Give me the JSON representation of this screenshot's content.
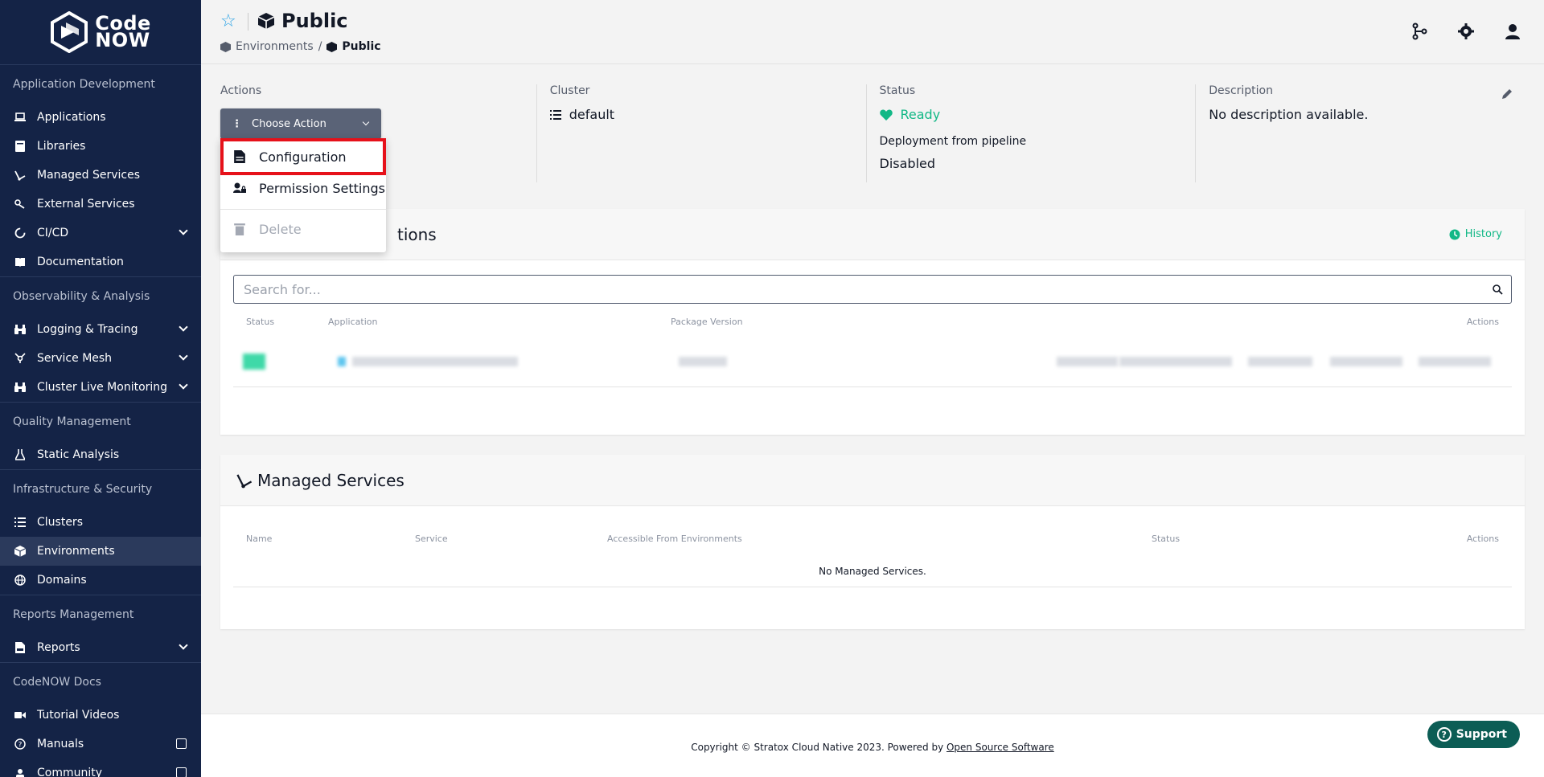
{
  "sidebar": {
    "logo_line1": "Code",
    "logo_line2": "NOW",
    "sections": [
      {
        "label": "Application Development",
        "items": [
          {
            "label": "Applications",
            "icon": "laptop-icon"
          },
          {
            "label": "Libraries",
            "icon": "book-icon"
          },
          {
            "label": "Managed Services",
            "icon": "managed-services-icon"
          },
          {
            "label": "External Services",
            "icon": "external-services-icon"
          },
          {
            "label": "CI/CD",
            "icon": "cicd-icon",
            "expand": true
          },
          {
            "label": "Documentation",
            "icon": "documentation-icon"
          }
        ]
      },
      {
        "label": "Observability & Analysis",
        "items": [
          {
            "label": "Logging & Tracing",
            "icon": "binoculars-icon",
            "expand": true
          },
          {
            "label": "Service Mesh",
            "icon": "service-mesh-icon",
            "expand": true
          },
          {
            "label": "Cluster Live Monitoring",
            "icon": "binoculars-icon",
            "expand": true
          }
        ]
      },
      {
        "label": "Quality Management",
        "items": [
          {
            "label": "Static Analysis",
            "icon": "flask-icon"
          }
        ]
      },
      {
        "label": "Infrastructure & Security",
        "items": [
          {
            "label": "Clusters",
            "icon": "list-icon"
          },
          {
            "label": "Environments",
            "icon": "cube-icon",
            "active": true
          },
          {
            "label": "Domains",
            "icon": "globe-icon"
          }
        ]
      },
      {
        "label": "Reports Management",
        "items": [
          {
            "label": "Reports",
            "icon": "csv-file-icon",
            "expand": true
          }
        ]
      },
      {
        "label": "CodeNOW Docs",
        "items": [
          {
            "label": "Tutorial Videos",
            "icon": "video-icon"
          },
          {
            "label": "Manuals",
            "icon": "question-circle-icon",
            "external": true
          },
          {
            "label": "Community",
            "icon": "community-icon",
            "external": true
          }
        ]
      }
    ]
  },
  "header": {
    "title": "Public",
    "breadcrumb": {
      "parent": "Environments",
      "separator": "/",
      "current": "Public"
    },
    "accent_star_color": "#2aa2e6"
  },
  "info": {
    "actions_label": "Actions",
    "choose_action": "Choose Action",
    "cluster_label": "Cluster",
    "cluster_value": "default",
    "status_label": "Status",
    "status_value": "Ready",
    "status_color": "#12b886",
    "deploy_label": "Deployment from pipeline",
    "deploy_value": "Disabled",
    "description_label": "Description",
    "description_value": "No description available."
  },
  "dropdown": {
    "items": [
      {
        "label": "Configuration",
        "highlight": true
      },
      {
        "label": "Permission Settings"
      },
      {
        "label": "Delete",
        "disabled": true
      }
    ],
    "highlight_color": "#e6111a"
  },
  "applications_card": {
    "title_visible": "tions",
    "history": "History",
    "search_placeholder": "Search for...",
    "columns": [
      "Status",
      "Application",
      "Package Version",
      "Actions"
    ]
  },
  "managed_services_card": {
    "title": "Managed Services",
    "columns": [
      "Name",
      "Service",
      "Accessible From Environments",
      "Status",
      "Actions"
    ],
    "empty": "No Managed Services."
  },
  "footer": {
    "copyright": "Copyright © Stratox Cloud Native 2023. Powered by ",
    "link": "Open Source Software",
    "support": "Support"
  }
}
